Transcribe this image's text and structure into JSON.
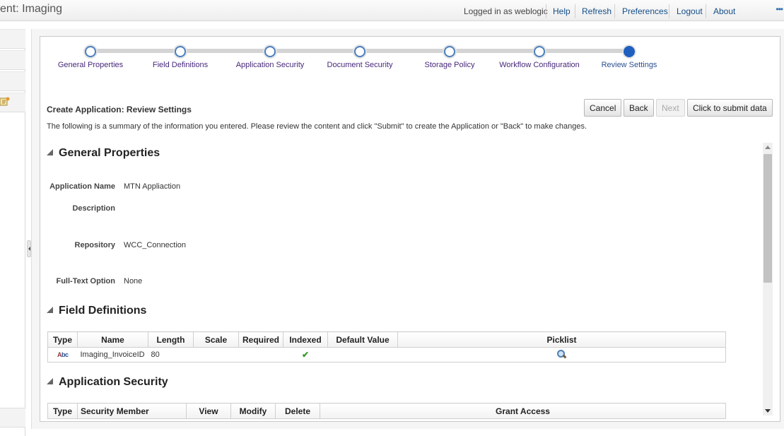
{
  "header": {
    "title": "ent: Imaging",
    "logged_in": "Logged in as weblogic",
    "links": [
      "Help",
      "Refresh",
      "Preferences",
      "Logout",
      "About"
    ]
  },
  "train": {
    "steps": [
      "General Properties",
      "Field Definitions",
      "Application Security",
      "Document Security",
      "Storage Policy",
      "Workflow Configuration",
      "Review Settings"
    ],
    "current_index": 6
  },
  "page": {
    "heading": "Create Application: Review Settings",
    "summary": "The following is a summary of the information you entered. Please review the content and click \"Submit\" to create the Application or \"Back\" to make changes."
  },
  "buttons": {
    "cancel": "Cancel",
    "back": "Back",
    "next": "Next",
    "submit": "Click to submit data"
  },
  "general_properties": {
    "title": "General Properties",
    "fields": {
      "application_name": {
        "label": "Application Name",
        "value": "MTN Appliaction"
      },
      "description": {
        "label": "Description",
        "value": ""
      },
      "repository": {
        "label": "Repository",
        "value": "WCC_Connection"
      },
      "full_text": {
        "label": "Full-Text Option",
        "value": "None"
      }
    }
  },
  "field_definitions": {
    "title": "Field Definitions",
    "columns": [
      "Type",
      "Name",
      "Length",
      "Scale",
      "Required",
      "Indexed",
      "Default Value",
      "Picklist"
    ],
    "rows": [
      {
        "type_icon": "abc-text-icon",
        "type_text": "Abc",
        "name": "Imaging_InvoiceID",
        "length": "80",
        "scale": "",
        "required": false,
        "indexed": true,
        "default_value": "",
        "picklist_icon": "search-icon"
      }
    ]
  },
  "application_security": {
    "title": "Application Security",
    "columns": [
      "Type",
      "Security Member",
      "View",
      "Modify",
      "Delete",
      "Grant Access"
    ]
  },
  "colors": {
    "accent": "#1f5fbf",
    "link": "#144e87",
    "train_label": "#47287a"
  }
}
